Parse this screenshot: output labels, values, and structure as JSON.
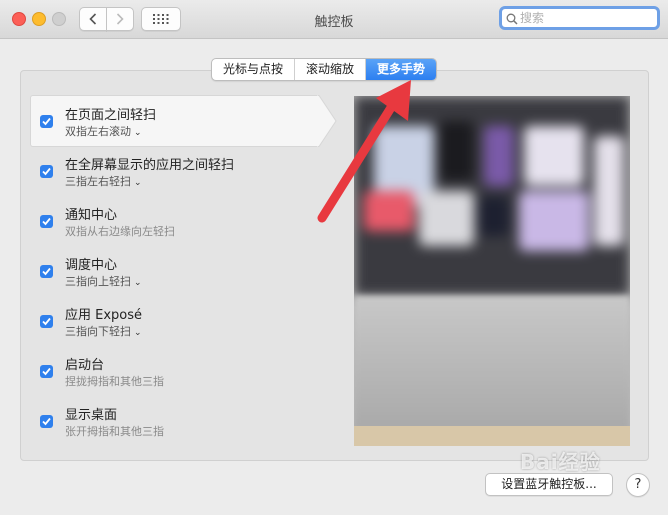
{
  "window": {
    "title": "触控板",
    "search_placeholder": "搜索"
  },
  "tabs": [
    {
      "label": "光标与点按",
      "active": false
    },
    {
      "label": "滚动缩放",
      "active": false
    },
    {
      "label": "更多手势",
      "active": true
    }
  ],
  "gestures": [
    {
      "name": "在页面之间轻扫",
      "detail": "双指左右滚动",
      "checked": true,
      "has_menu": true
    },
    {
      "name": "在全屏幕显示的应用之间轻扫",
      "detail": "三指左右轻扫",
      "checked": true,
      "has_menu": true
    },
    {
      "name": "通知中心",
      "detail": "双指从右边缘向左轻扫",
      "checked": true,
      "has_menu": false
    },
    {
      "name": "调度中心",
      "detail": "三指向上轻扫",
      "checked": true,
      "has_menu": true
    },
    {
      "name": "应用 Exposé",
      "detail": "三指向下轻扫",
      "checked": true,
      "has_menu": true
    },
    {
      "name": "启动台",
      "detail": "捏拢拇指和其他三指",
      "checked": true,
      "has_menu": false
    },
    {
      "name": "显示桌面",
      "detail": "张开拇指和其他三指",
      "checked": true,
      "has_menu": false
    }
  ],
  "footer": {
    "bluetooth_button": "设置蓝牙触控板...",
    "help_button": "?"
  },
  "watermark": "Bai经验",
  "colors": {
    "accent": "#2f80ed",
    "annotation_arrow": "#e8393f"
  }
}
